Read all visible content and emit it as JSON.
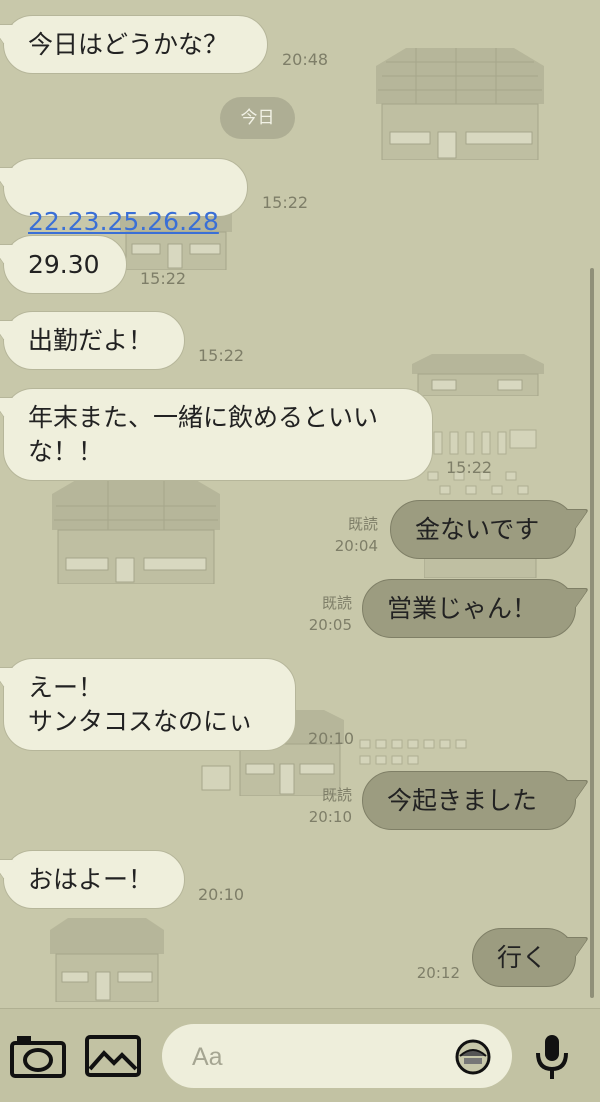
{
  "date_separator": "今日",
  "messages": [
    {
      "side": "in",
      "text": "今日はどうかな？",
      "time": "20:48"
    },
    {
      "side": "in",
      "text": "22.23.25.26.28",
      "time": "15:22",
      "is_link": true
    },
    {
      "side": "in",
      "text": "29.30",
      "time": "15:22"
    },
    {
      "side": "in",
      "text": "出勤だよ！",
      "time": "15:22"
    },
    {
      "side": "in",
      "text": "年末また、一緒に飲めるといいな！！",
      "time": "15:22"
    },
    {
      "side": "out",
      "text": "金ないです",
      "read": "既読",
      "time": "20:04"
    },
    {
      "side": "out",
      "text": "営業じゃん！",
      "read": "既読",
      "time": "20:05"
    },
    {
      "side": "in",
      "text": "えー！\nサンタコスなのにぃ",
      "time": "20:10"
    },
    {
      "side": "out",
      "text": "今起きました",
      "read": "既読",
      "time": "20:10"
    },
    {
      "side": "in",
      "text": "おはよー！",
      "time": "20:10"
    },
    {
      "side": "out",
      "text": "行く",
      "time": "20:12"
    }
  ],
  "input": {
    "placeholder": "Aa",
    "value": ""
  },
  "icons": {
    "camera": "camera-icon",
    "gallery": "image-icon",
    "sticker": "sticker-icon",
    "mic": "microphone-icon"
  },
  "colors": {
    "background": "#c8c8aa",
    "incoming_bubble": "#efefdc",
    "outgoing_bubble": "#9c9c80",
    "link": "#3a6fd6"
  }
}
